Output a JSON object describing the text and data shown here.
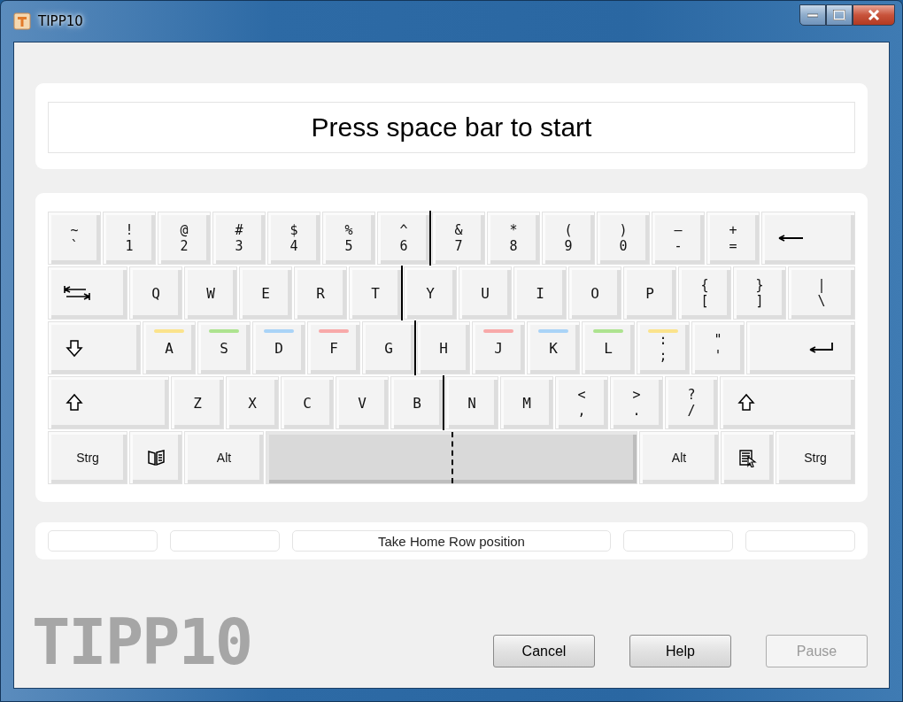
{
  "window": {
    "title": "TIPP10"
  },
  "prompt": "Press space bar to start",
  "keyboard": {
    "rows": [
      {
        "keys": [
          {
            "kind": "char",
            "upper": "~",
            "lower": "`"
          },
          {
            "kind": "char",
            "upper": "!",
            "lower": "1"
          },
          {
            "kind": "char",
            "upper": "@",
            "lower": "2"
          },
          {
            "kind": "char",
            "upper": "#",
            "lower": "3"
          },
          {
            "kind": "char",
            "upper": "$",
            "lower": "4"
          },
          {
            "kind": "char",
            "upper": "%",
            "lower": "5"
          },
          {
            "kind": "char",
            "upper": "^",
            "lower": "6",
            "split": true
          },
          {
            "kind": "char",
            "upper": "&",
            "lower": "7"
          },
          {
            "kind": "char",
            "upper": "*",
            "lower": "8"
          },
          {
            "kind": "char",
            "upper": "(",
            "lower": "9"
          },
          {
            "kind": "char",
            "upper": ")",
            "lower": "0"
          },
          {
            "kind": "char",
            "upper": "–",
            "lower": "-"
          },
          {
            "kind": "char",
            "upper": "+",
            "lower": "="
          },
          {
            "kind": "backspace"
          }
        ]
      },
      {
        "keys": [
          {
            "kind": "tab"
          },
          {
            "kind": "char",
            "lower": "Q"
          },
          {
            "kind": "char",
            "lower": "W"
          },
          {
            "kind": "char",
            "lower": "E"
          },
          {
            "kind": "char",
            "lower": "R"
          },
          {
            "kind": "char",
            "lower": "T",
            "split": true
          },
          {
            "kind": "char",
            "lower": "Y"
          },
          {
            "kind": "char",
            "lower": "U"
          },
          {
            "kind": "char",
            "lower": "I"
          },
          {
            "kind": "char",
            "lower": "O"
          },
          {
            "kind": "char",
            "lower": "P"
          },
          {
            "kind": "char",
            "upper": "{",
            "lower": "["
          },
          {
            "kind": "char",
            "upper": "}",
            "lower": "]"
          },
          {
            "kind": "char",
            "upper": "|",
            "lower": "\\"
          }
        ]
      },
      {
        "keys": [
          {
            "kind": "caps"
          },
          {
            "kind": "char",
            "lower": "A",
            "color": "#fbe38c"
          },
          {
            "kind": "char",
            "lower": "S",
            "color": "#ade38f"
          },
          {
            "kind": "char",
            "lower": "D",
            "color": "#a9d3f7"
          },
          {
            "kind": "char",
            "lower": "F",
            "color": "#f8a9a9"
          },
          {
            "kind": "char",
            "lower": "G",
            "split": true
          },
          {
            "kind": "char",
            "lower": "H"
          },
          {
            "kind": "char",
            "lower": "J",
            "color": "#f8a9a9"
          },
          {
            "kind": "char",
            "lower": "K",
            "color": "#a9d3f7"
          },
          {
            "kind": "char",
            "lower": "L",
            "color": "#ade38f"
          },
          {
            "kind": "char",
            "upper": ":",
            "lower": ";",
            "color": "#fbe38c"
          },
          {
            "kind": "char",
            "upper": "\"",
            "lower": "'"
          },
          {
            "kind": "enter"
          }
        ]
      },
      {
        "keys": [
          {
            "kind": "shift"
          },
          {
            "kind": "char",
            "lower": "Z"
          },
          {
            "kind": "char",
            "lower": "X"
          },
          {
            "kind": "char",
            "lower": "C"
          },
          {
            "kind": "char",
            "lower": "V"
          },
          {
            "kind": "char",
            "lower": "B",
            "split": true
          },
          {
            "kind": "char",
            "lower": "N"
          },
          {
            "kind": "char",
            "lower": "M"
          },
          {
            "kind": "char",
            "upper": "<",
            "lower": ","
          },
          {
            "kind": "char",
            "upper": ">",
            "lower": "."
          },
          {
            "kind": "char",
            "upper": "?",
            "lower": "/"
          },
          {
            "kind": "shift"
          }
        ]
      },
      {
        "keys": [
          {
            "kind": "label",
            "lower": "Strg"
          },
          {
            "kind": "win"
          },
          {
            "kind": "label",
            "lower": "Alt"
          },
          {
            "kind": "space",
            "split": true
          },
          {
            "kind": "label",
            "lower": "Alt"
          },
          {
            "kind": "menu"
          },
          {
            "kind": "label",
            "lower": "Strg"
          }
        ]
      }
    ]
  },
  "status": [
    {
      "kind": "field"
    },
    {
      "kind": "field"
    },
    {
      "kind": "field",
      "text": "Take Home Row position"
    },
    {
      "kind": "field"
    },
    {
      "kind": "field"
    }
  ],
  "logo": "TIPP10",
  "buttons": [
    {
      "label": "Cancel",
      "disabled": false
    },
    {
      "label": "Help",
      "disabled": false
    },
    {
      "label": "Pause",
      "disabled": true
    }
  ]
}
